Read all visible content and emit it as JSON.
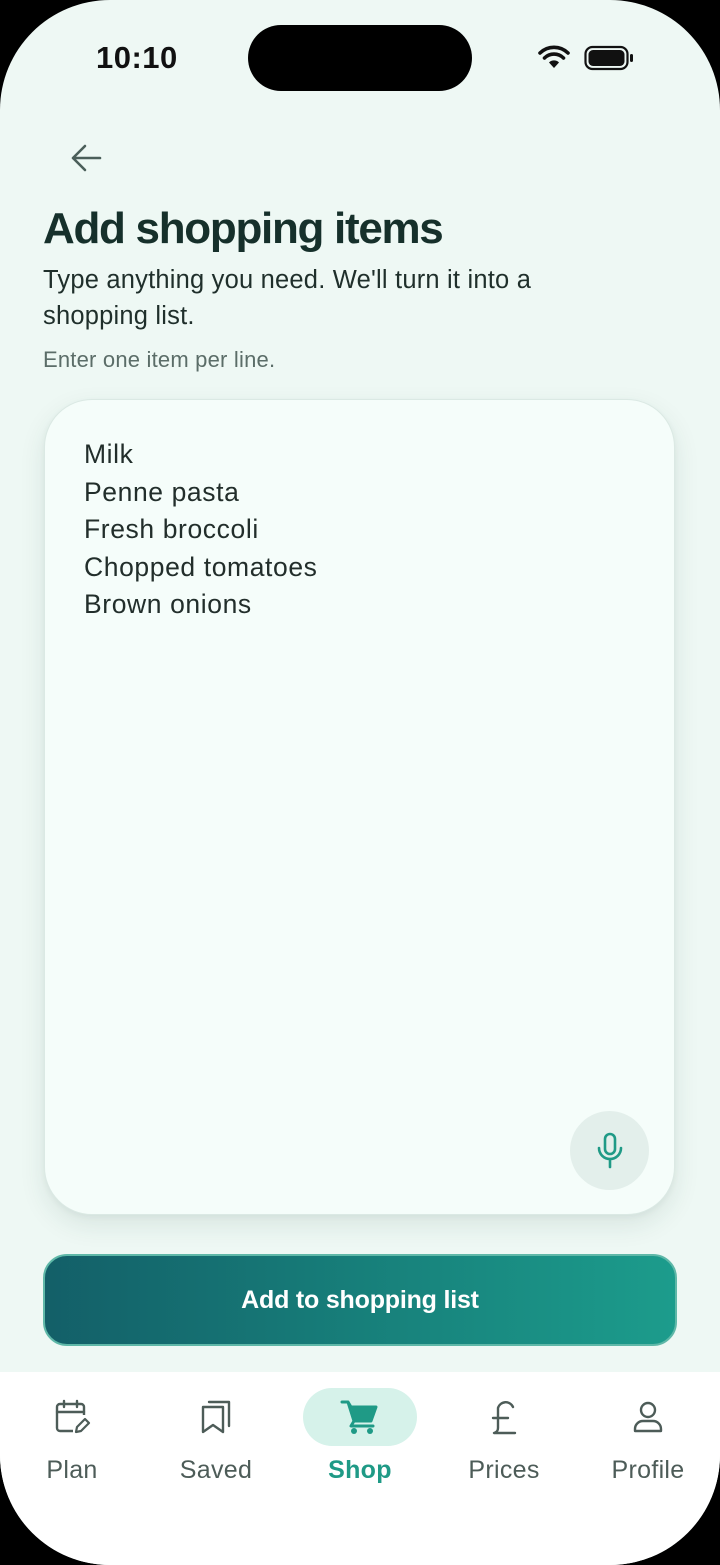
{
  "status_bar": {
    "time": "10:10"
  },
  "header": {
    "back_icon": "arrow-left-icon",
    "title": "Add shopping items",
    "subtitle": "Type anything you need. We'll turn it into a shopping list.",
    "hint": "Enter one item per line."
  },
  "input": {
    "items": [
      "Milk",
      "Penne pasta",
      "Fresh broccoli",
      "Chopped tomatoes",
      "Brown onions"
    ],
    "mic_icon": "microphone-icon"
  },
  "primary_button": {
    "label": "Add to shopping list"
  },
  "tab_bar": {
    "tabs": [
      {
        "label": "Plan",
        "icon": "calendar-edit-icon",
        "active": false
      },
      {
        "label": "Saved",
        "icon": "bookmark-icon",
        "active": false
      },
      {
        "label": "Shop",
        "icon": "cart-icon",
        "active": true
      },
      {
        "label": "Prices",
        "icon": "pound-icon",
        "active": false
      },
      {
        "label": "Profile",
        "icon": "user-icon",
        "active": false
      }
    ]
  },
  "colors": {
    "background": "#eef8f4",
    "accent": "#1f9a86",
    "button_gradient_start": "#135f68",
    "button_gradient_end": "#1c9c8c",
    "title": "#16302b"
  }
}
